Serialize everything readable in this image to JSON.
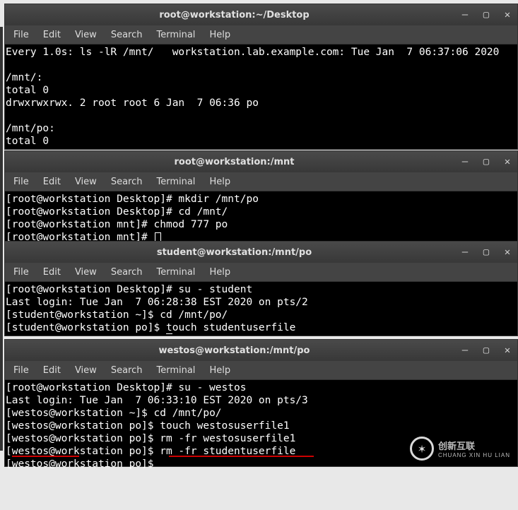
{
  "menu": {
    "file": "File",
    "edit": "Edit",
    "view": "View",
    "search": "Search",
    "terminal": "Terminal",
    "help": "Help"
  },
  "w1": {
    "title": "root@workstation:~/Desktop",
    "line1": "Every 1.0s: ls -lR /mnt/   workstation.lab.example.com: Tue Jan  7 06:37:06 2020",
    "line2": "/mnt/:",
    "line3": "total 0",
    "line4": "drwxrwxrwx. 2 root root 6 Jan  7 06:36 po",
    "line5": "/mnt/po:",
    "line6": "total 0"
  },
  "w2": {
    "title": "root@workstation:/mnt",
    "l1": "[root@workstation Desktop]# mkdir /mnt/po",
    "l2": "[root@workstation Desktop]# cd /mnt/",
    "l3": "[root@workstation mnt]# chmod 777 po",
    "l4": "[root@workstation mnt]# "
  },
  "w3": {
    "title": "student@workstation:/mnt/po",
    "l1": "[root@workstation Desktop]# su - student",
    "l2": "Last login: Tue Jan  7 06:28:38 EST 2020 on pts/2",
    "l3": "[student@workstation ~]$ cd /mnt/po/",
    "l4a": "[student@workstation po]$ ",
    "l4b": "t",
    "l4c": "ouch studentuserfile"
  },
  "w4": {
    "title": "westos@workstation:/mnt/po",
    "l1": "[root@workstation Desktop]# su - westos",
    "l2": "Last login: Tue Jan  7 06:33:10 EST 2020 on pts/3",
    "l3": "[westos@workstation ~]$ cd /mnt/po/",
    "l4": "[westos@workstation po]$ touch westosuserfile1",
    "l5": "[westos@workstation po]$ rm -fr westosuserfile1",
    "l6": "[westos@workstation po]$ rm -fr studentuserfile",
    "l7": "[westos@workstation po]$ "
  },
  "watermark": {
    "cn": "创新互联",
    "en": "CHUANG XIN HU LIAN"
  }
}
